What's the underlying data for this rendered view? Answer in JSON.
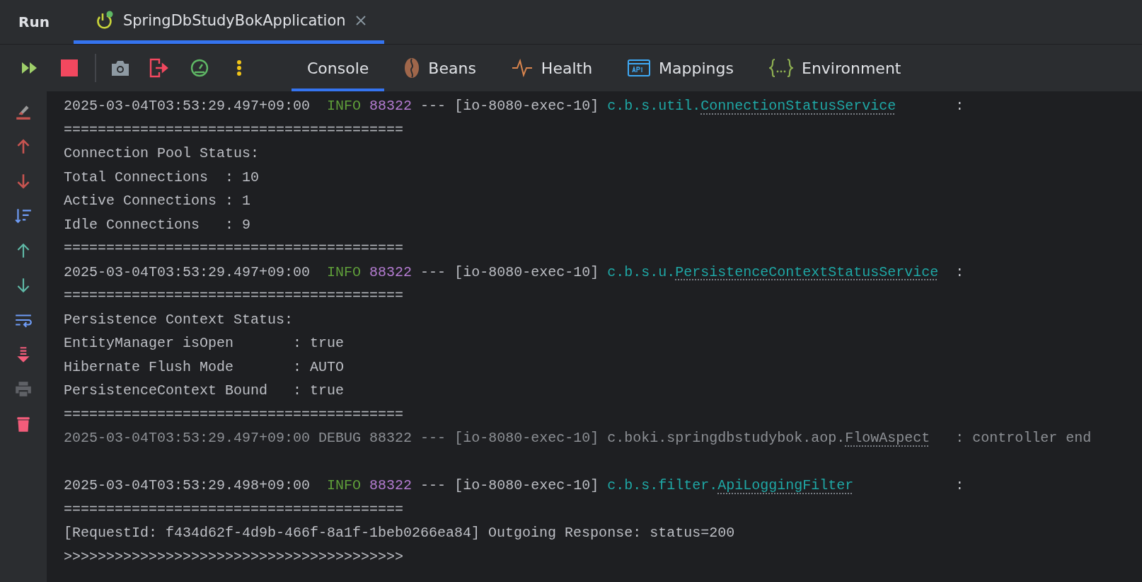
{
  "run_bar": {
    "title": "Run",
    "tabs": [
      {
        "label": "SpringDbStudyBokApplication",
        "selected": true,
        "running": true
      }
    ]
  },
  "toolbar": {
    "views": [
      {
        "label": "Console",
        "selected": true
      },
      {
        "label": "Beans",
        "selected": false
      },
      {
        "label": "Health",
        "selected": false
      },
      {
        "label": "Mappings",
        "selected": false
      },
      {
        "label": "Environment",
        "selected": false
      }
    ]
  },
  "console": {
    "lines": [
      {
        "kind": "log_info",
        "timestamp": "2025-03-04T03:53:29.497+09:00",
        "level": "INFO",
        "pid": "88322",
        "dashes": "---",
        "thread": "[io-8080-exec-10]",
        "logger_package": "c.b.s.util.",
        "logger_class": "ConnectionStatusService",
        "message": ":"
      },
      {
        "kind": "text",
        "text": "========================================"
      },
      {
        "kind": "text",
        "text": "Connection Pool Status:"
      },
      {
        "kind": "text",
        "text": "Total Connections  : 10"
      },
      {
        "kind": "text",
        "text": "Active Connections : 1"
      },
      {
        "kind": "text",
        "text": "Idle Connections   : 9"
      },
      {
        "kind": "text",
        "text": "========================================"
      },
      {
        "kind": "log_info",
        "timestamp": "2025-03-04T03:53:29.497+09:00",
        "level": "INFO",
        "pid": "88322",
        "dashes": "---",
        "thread": "[io-8080-exec-10]",
        "logger_package": "c.b.s.u.",
        "logger_class": "PersistenceContextStatusService",
        "message": ":"
      },
      {
        "kind": "text",
        "text": "========================================"
      },
      {
        "kind": "text",
        "text": "Persistence Context Status:"
      },
      {
        "kind": "text",
        "text": "EntityManager isOpen       : true"
      },
      {
        "kind": "text",
        "text": "Hibernate Flush Mode       : AUTO"
      },
      {
        "kind": "text",
        "text": "PersistenceContext Bound   : true"
      },
      {
        "kind": "text",
        "text": "========================================"
      },
      {
        "kind": "log_debug",
        "timestamp": "2025-03-04T03:53:29.497+09:00",
        "level": "DEBUG",
        "pid": "88322",
        "dashes": "---",
        "thread": "[io-8080-exec-10]",
        "logger_package": "c.boki.springdbstudybok.aop.",
        "logger_class": "FlowAspect",
        "message": ": controller end"
      },
      {
        "kind": "blank"
      },
      {
        "kind": "log_info",
        "timestamp": "2025-03-04T03:53:29.498+09:00",
        "level": "INFO",
        "pid": "88322",
        "dashes": "---",
        "thread": "[io-8080-exec-10]",
        "logger_package": "c.b.s.filter.",
        "logger_class": "ApiLoggingFilter",
        "message": ":"
      },
      {
        "kind": "text",
        "text": "========================================"
      },
      {
        "kind": "text",
        "text": "[RequestId: f434d62f-4d9b-466f-8a1f-1beb0266ea84] Outgoing Response: status=200"
      },
      {
        "kind": "text",
        "text": ">>>>>>>>>>>>>>>>>>>>>>>>>>>>>>>>>>>>>>>>"
      }
    ]
  }
}
